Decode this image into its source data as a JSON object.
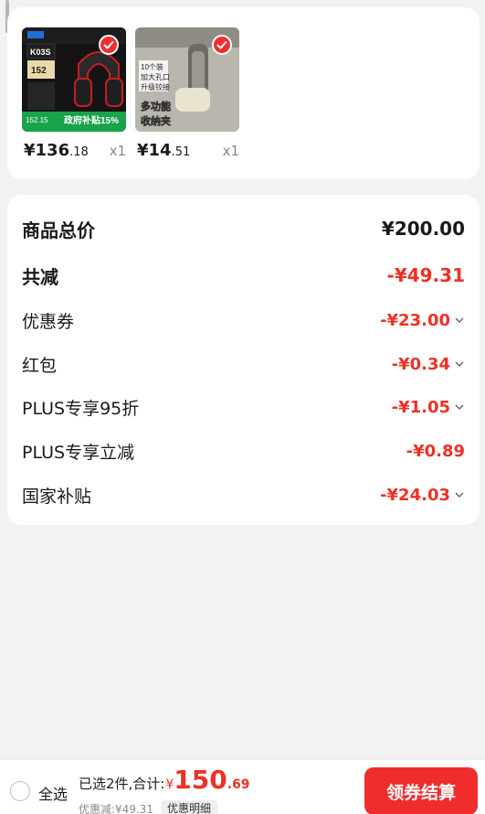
{
  "products": [
    {
      "image_text": [
        "K03S",
        "152",
        "政府补贴15%",
        "152.15"
      ],
      "price_int": "¥136",
      "price_dec": ".18",
      "qty": "x1",
      "selected": true
    },
    {
      "image_text": [
        "10个装",
        "加大孔口",
        "升级铰接",
        "多功能",
        "收纳夹"
      ],
      "price_int": "¥14",
      "price_dec": ".51",
      "qty": "x1",
      "selected": true
    }
  ],
  "summary": {
    "total_label": "商品总价",
    "total_value": "¥200.00",
    "reduce_label": "共减",
    "reduce_value": "-¥49.31",
    "coupon_label": "优惠券",
    "coupon_value": "-¥23.00",
    "redpacket_label": "红包",
    "redpacket_value": "-¥0.34",
    "plus95_label": "PLUS专享95折",
    "plus95_value": "-¥1.05",
    "plusreduce_label": "PLUS专享立减",
    "plusreduce_value": "-¥0.89",
    "subsidy_label": "国家补贴",
    "subsidy_value": "-¥24.03"
  },
  "bottom": {
    "select_all": "全选",
    "selected_text": "已选2件,合计:",
    "currency": "¥",
    "total_int": "150",
    "total_dec": ".69",
    "discount_text": "优惠减:¥49.31",
    "detail_label": "优惠明细",
    "checkout_label": "领券结算"
  },
  "colors": {
    "accent": "#ee3124",
    "button": "#f12c2c",
    "background": "#f2f2f2"
  },
  "icons": [
    "check-icon",
    "chevron-down-icon",
    "radio-icon"
  ]
}
